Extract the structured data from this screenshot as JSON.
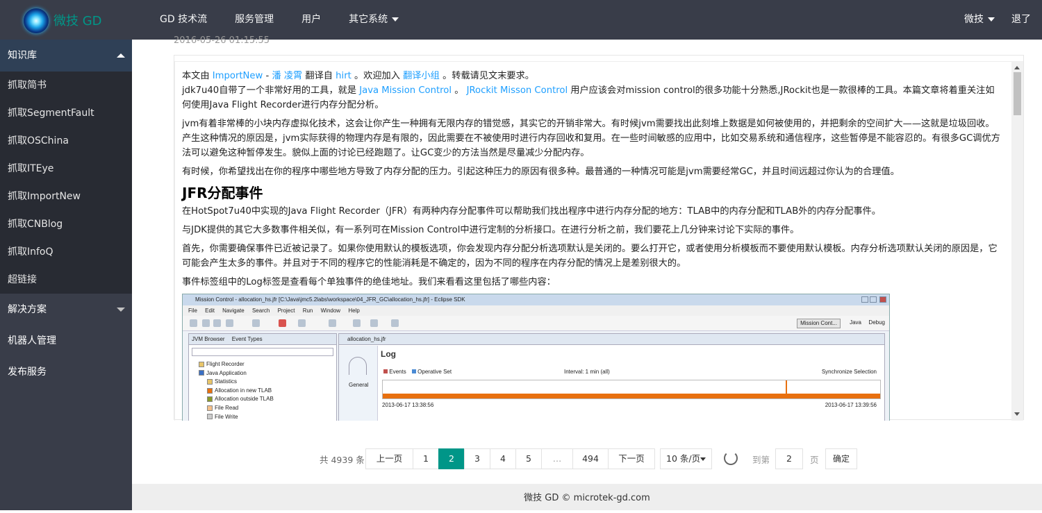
{
  "app": {
    "logo_text": "微技 GD"
  },
  "topnav": {
    "items": [
      "GD 技术流",
      "服务管理",
      "用户",
      "其它系统"
    ]
  },
  "topright": {
    "user": "微技",
    "logout": "退了"
  },
  "sidebar": {
    "group1": {
      "title": "知识库",
      "items": [
        "抓取简书",
        "抓取SegmentFault",
        "抓取OSChina",
        "抓取ITEye",
        "抓取ImportNew",
        "抓取CNBlog",
        "抓取InfoQ",
        "超链接"
      ]
    },
    "group2": {
      "title": "解决方案"
    },
    "robot": "机器人管理",
    "publish": "发布服务"
  },
  "article": {
    "date": "2016-05-26 01:15:55",
    "intro": {
      "t1": "本文由 ",
      "l1": "ImportNew",
      "t2": " - ",
      "l2": "潘 凌霄",
      "t3": " 翻译自 ",
      "l3": "hirt",
      "t4": " 。欢迎加入 ",
      "l4": "翻译小组",
      "t5": " 。转载请见文末要求。"
    },
    "p1": {
      "t1": "jdk7u40自带了一个非常好用的工具，就是 ",
      "l1": "Java Mission Control",
      "t2": " 。 ",
      "l2": "JRockit Misson Control",
      "t3": " 用户应该会对mission control的很多功能十分熟悉,JRockit也是一款很棒的工具。本篇文章将着重关注如何使用Java Flight Recorder进行内存分配分析。"
    },
    "p2": "jvm有着非常棒的小块内存虚拟化技术，这会让你产生一种拥有无限内存的错觉感，其实它的开销非常大。有时候jvm需要找出此刻堆上数据是如何被使用的，并把剩余的空间扩大——这就是垃圾回收。产生这种情况的原因是，jvm实际获得的物理内存是有限的，因此需要在不被使用时进行内存回收和复用。在一些时间敏感的应用中，比如交易系统和通信程序，这些暂停是不能容忍的。有很多GC调优方法可以避免这种暂停发生。貌似上面的讨论已经跑题了。让GC变少的方法当然是尽量减少分配内存。",
    "p3": "有时候，你希望找出在你的程序中哪些地方导致了内存分配的压力。引起这种压力的原因有很多种。最普通的一种情况可能是jvm需要经常GC，并且时间远超过你认为的合理值。",
    "h3": "JFR分配事件",
    "p4": "在HotSpot7u40中实现的Java Flight Recorder（JFR）有两种内存分配事件可以帮助我们找出程序中进行内存分配的地方：TLAB中的内存分配和TLAB外的内存分配事件。",
    "p5": "与JDK提供的其它大多数事件相关似，有一系列可在Mission Control中进行定制的分析接口。在进行分析之前，我们要花上几分钟来讨论下实际的事件。",
    "p6": "首先，你需要确保事件已近被记录了。如果你使用默认的模板选项，你会发现内存分配分析选项默认是关闭的。要么打开它，或者使用分析模板而不要使用默认模板。内存分析选项默认关闭的原因是，它可能会产生太多的事件。并且对于不同的程序它的性能消耗是不确定的，因为不同的程序在内存分配的情况上是差别很大的。",
    "p7": "事件标签组中的Log标签是查看每个单独事件的绝佳地址。我们来看看这里包括了哪些内容："
  },
  "screenshot": {
    "title": "Mission Control - allocation_hs.jfr [C:\\Java\\jmc5.2labs\\workspace\\04_JFR_GC\\allocation_hs.jfr] - Eclipse SDK",
    "menu": [
      "File",
      "Edit",
      "Navigate",
      "Search",
      "Project",
      "Run",
      "Window",
      "Help"
    ],
    "perspectives": [
      "Mission Cont...",
      "Java",
      "Debug"
    ],
    "left_tabs": [
      "JVM Browser",
      "Event Types"
    ],
    "tree": [
      "Flight Recorder",
      "Java Application",
      "Statistics",
      "Allocation in new TLAB",
      "Allocation outside TLAB",
      "File Read",
      "File Write"
    ],
    "tree_colors": [
      "#e8c56a",
      "#3a6fc4",
      "#e8c56a",
      "#e8700f",
      "#8a9a2a",
      "#f4c08a",
      "#cccccc"
    ],
    "editor_tab": "allocation_hs.jfr",
    "general_label": "General",
    "log_title": "Log",
    "legend": [
      "Events",
      "Operative Set"
    ],
    "interval": "Interval: 1 min (all)",
    "sync": "Synchronize Selection",
    "time_start": "2013-06-17 13:38:56",
    "time_end": "2013-06-17 13:39:56"
  },
  "pager": {
    "total": "共 4939 条",
    "prev": "上一页",
    "pages": [
      "1",
      "2",
      "3",
      "4",
      "5",
      "…",
      "494"
    ],
    "current": "2",
    "next": "下一页",
    "limit": "10 条/页",
    "goto": "到第",
    "input_value": "2",
    "page_word": "页",
    "ok": "确定"
  },
  "footer": {
    "text": "微技 GD © microtek-gd.com"
  },
  "colors": {
    "accent": "#009688",
    "header_bg": "#393D49",
    "link": "#1e9fff"
  }
}
